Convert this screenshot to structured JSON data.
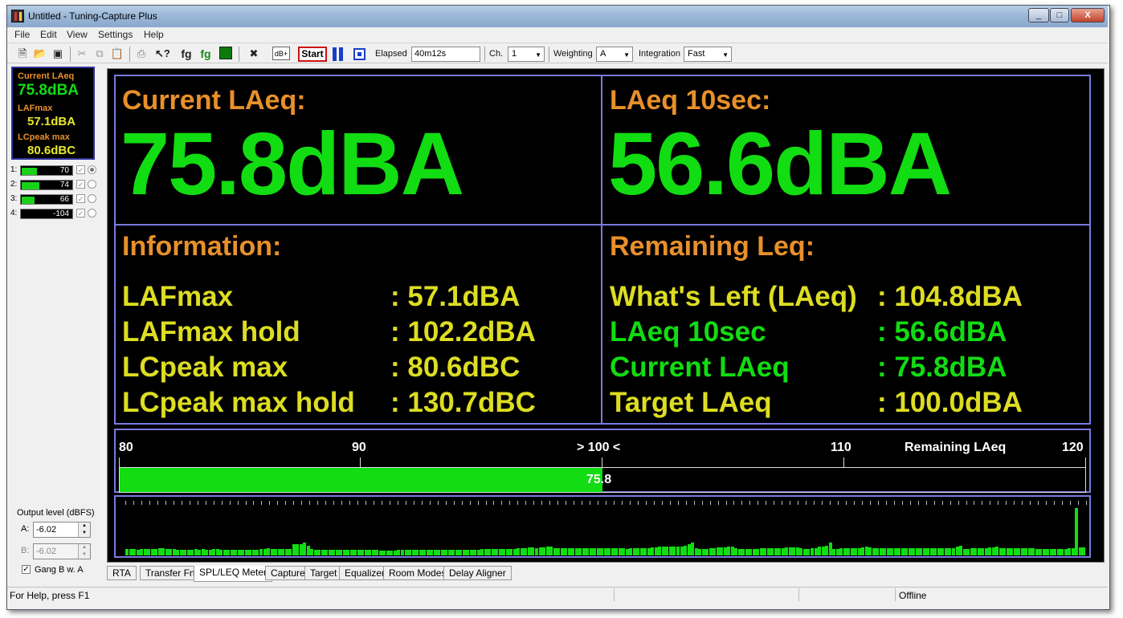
{
  "window": {
    "title": "Untitled - Tuning-Capture Plus",
    "controls": [
      "_",
      "□",
      "X"
    ]
  },
  "menu": [
    "File",
    "Edit",
    "View",
    "Settings",
    "Help"
  ],
  "toolbar": {
    "icons": [
      "new-file-icon",
      "open-folder-icon",
      "save-icon",
      "cut-icon",
      "copy-icon",
      "paste-icon",
      "print-icon",
      "help-pointer-icon",
      "fg-icon",
      "fg-green-icon",
      "chart-icon",
      "tools-icon"
    ],
    "db_plus_label": "dB+",
    "start_label": "Start",
    "elapsed_label": "Elapsed",
    "elapsed_value": "40m12s",
    "channel_label": "Ch.",
    "channel_value": "1",
    "weighting_label": "Weighting",
    "weighting_value": "A",
    "integration_label": "Integration",
    "integration_value": "Fast"
  },
  "meter_panel": {
    "current_laeq_label": "Current LAeq",
    "current_laeq_value": "75.8dBA",
    "lafmax_label": "LAFmax",
    "lafmax_value": "57.1dBA",
    "lcpeak_label": "LCpeak max",
    "lcpeak_value": "80.6dBC",
    "colors": {
      "green": "#12dc12",
      "yellow": "#e8e82a",
      "orange": "#e8902a"
    }
  },
  "channels": [
    {
      "num": "1:",
      "value": "70",
      "level": 0.3,
      "checked": true,
      "selected": true
    },
    {
      "num": "2:",
      "value": "74",
      "level": 0.35,
      "checked": true,
      "selected": false
    },
    {
      "num": "3:",
      "value": "66",
      "level": 0.25,
      "checked": true,
      "selected": false
    },
    {
      "num": "4:",
      "value": "-104",
      "level": 0.0,
      "checked": true,
      "selected": false
    }
  ],
  "output": {
    "label": "Output level (dBFS)",
    "a_label": "A:",
    "a_value": "-6.02",
    "b_label": "B:",
    "b_value": "-6.02",
    "gang_label": "Gang B w. A",
    "gang_checked": true
  },
  "display": {
    "current_heading": "Current LAeq:",
    "current_value": "75.8dBA",
    "laeq10_heading": "LAeq 10sec:",
    "laeq10_value": "56.6dBA",
    "info_heading": "Information:",
    "info": [
      {
        "label": "LAFmax",
        "value": ": 57.1dBA"
      },
      {
        "label": "LAFmax hold",
        "value": ": 102.2dBA"
      },
      {
        "label": "LCpeak max",
        "value": ": 80.6dBC"
      },
      {
        "label": "LCpeak max hold",
        "value": ": 130.7dBC"
      }
    ],
    "remaining_heading": "Remaining Leq:",
    "remaining": [
      {
        "label": "What's Left (LAeq)",
        "value": ": 104.8dBA",
        "color": "yellow"
      },
      {
        "label": "LAeq 10sec",
        "value": ": 56.6dBA",
        "color": "green"
      },
      {
        "label": "Current LAeq",
        "value": ": 75.8dBA",
        "color": "green"
      },
      {
        "label": "Target LAeq",
        "value": ": 100.0dBA",
        "color": "yellow"
      }
    ]
  },
  "scale": {
    "labels": [
      "80",
      "90",
      "> 100 <",
      "110",
      "120"
    ],
    "title": "Remaining LAeq",
    "min": 80,
    "max": 120,
    "bar_value": 100,
    "bar_label": "75.8"
  },
  "history": {
    "values": [
      13,
      13,
      13,
      12,
      13,
      13,
      13,
      13,
      13,
      14,
      14,
      13,
      13,
      13,
      12,
      12,
      12,
      12,
      12,
      13,
      12,
      13,
      12,
      12,
      13,
      13,
      12,
      12,
      12,
      12,
      11,
      11,
      12,
      12,
      12,
      12,
      12,
      13,
      13,
      14,
      13,
      13,
      13,
      13,
      13,
      13,
      22,
      22,
      23,
      26,
      20,
      13,
      12,
      12,
      12,
      12,
      11,
      11,
      11,
      11,
      11,
      11,
      11,
      11,
      11,
      11,
      11,
      11,
      11,
      11,
      10,
      10,
      10,
      10,
      10,
      11,
      11,
      11,
      11,
      11,
      11,
      11,
      11,
      11,
      11,
      11,
      11,
      11,
      11,
      11,
      12,
      12,
      12,
      12,
      12,
      12,
      12,
      12,
      13,
      13,
      13,
      13,
      13,
      13,
      13,
      13,
      13,
      13,
      14,
      15,
      15,
      16,
      16,
      15,
      16,
      16,
      17,
      17,
      15,
      15,
      15,
      15,
      15,
      15,
      15,
      15,
      15,
      15,
      15,
      15,
      15,
      15,
      15,
      15,
      15,
      15,
      14,
      14,
      13,
      14,
      14,
      14,
      14,
      15,
      15,
      16,
      16,
      17,
      17,
      18,
      17,
      17,
      18,
      18,
      20,
      22,
      26,
      14,
      13,
      13,
      13,
      14,
      14,
      16,
      16,
      16,
      17,
      17,
      14,
      13,
      13,
      13,
      13,
      13,
      13,
      14,
      14,
      14,
      14,
      14,
      15,
      15,
      16,
      16,
      16,
      16,
      15,
      13,
      13,
      14,
      14,
      17,
      18,
      20,
      25,
      13,
      13,
      14,
      14,
      14,
      15,
      15,
      15,
      16,
      17,
      16,
      14,
      14,
      14,
      14,
      15,
      15,
      15,
      15,
      15,
      15,
      15,
      14,
      14,
      14,
      14,
      14,
      14,
      14,
      14,
      14,
      14,
      14,
      14,
      17,
      20,
      13,
      13,
      14,
      14,
      15,
      15,
      15,
      16,
      16,
      17,
      14,
      14,
      14,
      14,
      14,
      14,
      14,
      14,
      14,
      14,
      13,
      13,
      13,
      13,
      13,
      13,
      13,
      13,
      13,
      14,
      14,
      95,
      16,
      16
    ]
  },
  "tabs": [
    "RTA",
    "Transfer Fn",
    "SPL/LEQ Meter",
    "Capture",
    "Target",
    "Equalizer",
    "Room Modes",
    "Delay Aligner"
  ],
  "active_tab": "SPL/LEQ Meter",
  "status": {
    "help_text": "For Help, press F1",
    "state": "Offline"
  }
}
